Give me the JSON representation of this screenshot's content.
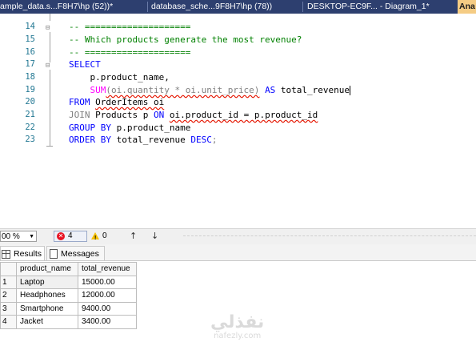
{
  "tabs": [
    {
      "label": "ample_data.s...F8H7\\hp (52))*"
    },
    {
      "label": "database_sche...9F8H7\\hp (78))"
    },
    {
      "label": "DESKTOP-EC9F... - Diagram_1*"
    },
    {
      "label": "Ana"
    }
  ],
  "editor": {
    "line_numbers": [
      "15",
      "16",
      "17",
      "18",
      "19",
      "20",
      "21",
      "22",
      "23"
    ],
    "first_line_number": "14",
    "line14": "-- ====================",
    "line15": "-- Which products generate the most revenue?",
    "line16": "-- ====================",
    "line17": "SELECT",
    "line18": "    p.product_name,",
    "line19_fn": "SUM",
    "line19_args": "(oi.quantity * oi.unit_price)",
    "line19_as": "AS",
    "line19_alias": " total_revenue",
    "line20_kw": "FROM",
    "line20_tbl": "OrderItems oi",
    "line21_kw": "JOIN",
    "line21_tbl": "Products p",
    "line21_on": "ON",
    "line21_cond": "oi.product_id = p.product_id",
    "line22_kw": "GROUP BY",
    "line22_col": "p.product_name",
    "line23_kw": "ORDER BY",
    "line23_col": "total_revenue",
    "line23_desc": "DESC",
    "line23_semi": ";"
  },
  "status": {
    "zoom": "00 %",
    "errors": "4",
    "warnings": "0",
    "up_arrow": "↑",
    "down_arrow": "↓"
  },
  "results_tabs": {
    "results": "Results",
    "messages": "Messages"
  },
  "results": {
    "columns": [
      "product_name",
      "total_revenue"
    ],
    "rows": [
      {
        "n": "1",
        "product_name": "Laptop",
        "total_revenue": "15000.00"
      },
      {
        "n": "2",
        "product_name": "Headphones",
        "total_revenue": "12000.00"
      },
      {
        "n": "3",
        "product_name": "Smartphone",
        "total_revenue": "9400.00"
      },
      {
        "n": "4",
        "product_name": "Jacket",
        "total_revenue": "3400.00"
      }
    ]
  },
  "watermark": {
    "arabic": "نفذلي",
    "latin": "nafezly.com"
  },
  "colors": {
    "tab_strip": "#2d3f6f",
    "active_tab": "#f5cc84",
    "comment": "#008000",
    "keyword": "#0000ff",
    "function": "#ff00ff",
    "error_squiggle": "#e51400"
  }
}
